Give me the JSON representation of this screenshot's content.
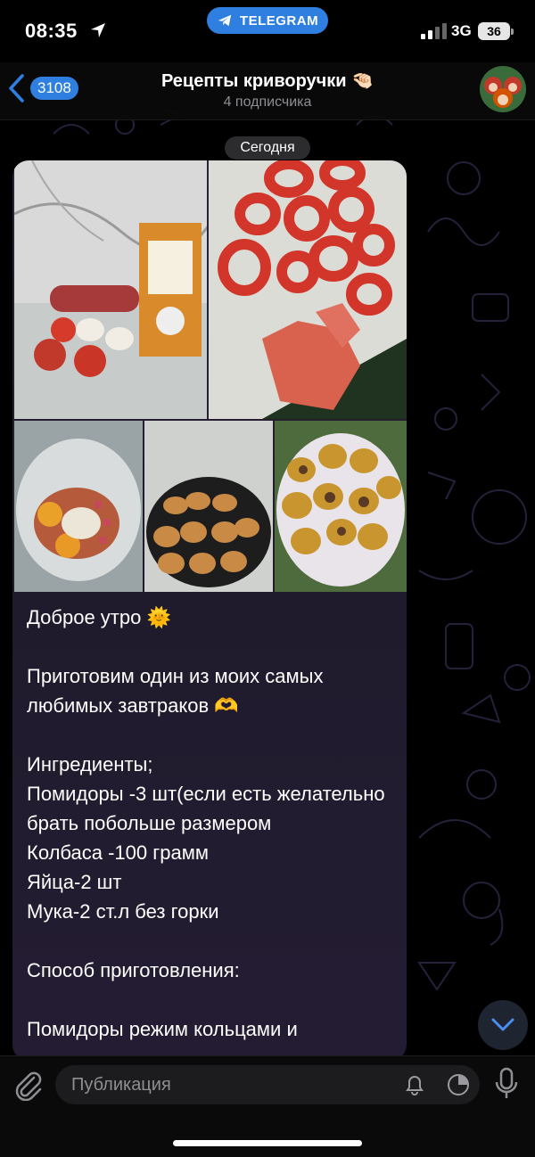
{
  "status_bar": {
    "time": "08:35",
    "return_app_label": "TELEGRAM",
    "network": "3G",
    "battery": "36"
  },
  "header": {
    "back_count": "3108",
    "title": "Рецепты криворучки 🤏🏻",
    "subtitle": "4 подписчика"
  },
  "chat": {
    "date_label": "Сегодня",
    "message_text": "Доброе утро 🌞\n\nПриготовим один из моих самых любимых завтраков 🫶\n\nИнгредиенты;\nПомидоры -3 шт(если есть желательно брать побольше размером\nКолбаса -100 грамм\nЯйца-2 шт\nМука-2 ст.л без горки\n\nСпособ приготовления:\n\nПомидоры режим кольцами и"
  },
  "composer": {
    "placeholder": "Публикация"
  },
  "icons": {
    "back": "chevron-left-icon",
    "location": "location-arrow-icon",
    "attach": "paperclip-icon",
    "bell": "bell-icon",
    "timer": "timer-icon",
    "mic": "microphone-icon",
    "scroll": "chevron-down-icon"
  },
  "colors": {
    "accent": "#2f7fe0",
    "bubble": "#2a2236",
    "background": "#000000"
  }
}
